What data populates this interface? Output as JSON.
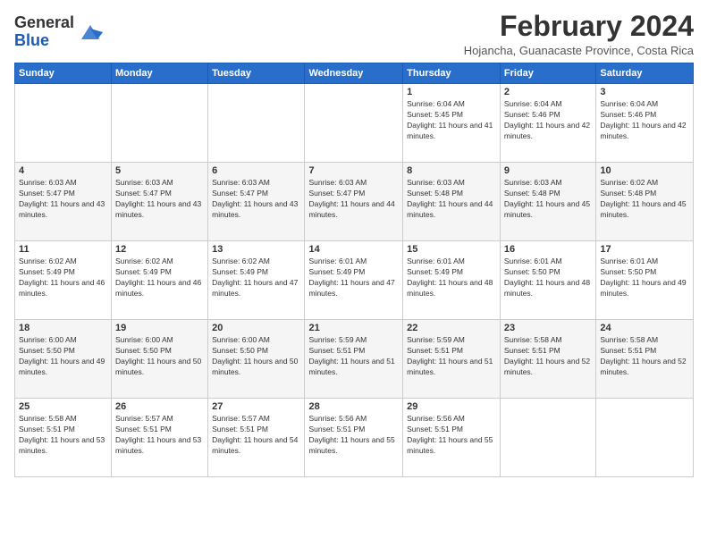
{
  "header": {
    "logo_line1": "General",
    "logo_line2": "Blue",
    "month": "February 2024",
    "location": "Hojancha, Guanacaste Province, Costa Rica"
  },
  "days_of_week": [
    "Sunday",
    "Monday",
    "Tuesday",
    "Wednesday",
    "Thursday",
    "Friday",
    "Saturday"
  ],
  "weeks": [
    [
      {
        "day": "",
        "info": ""
      },
      {
        "day": "",
        "info": ""
      },
      {
        "day": "",
        "info": ""
      },
      {
        "day": "",
        "info": ""
      },
      {
        "day": "1",
        "info": "Sunrise: 6:04 AM\nSunset: 5:45 PM\nDaylight: 11 hours and 41 minutes."
      },
      {
        "day": "2",
        "info": "Sunrise: 6:04 AM\nSunset: 5:46 PM\nDaylight: 11 hours and 42 minutes."
      },
      {
        "day": "3",
        "info": "Sunrise: 6:04 AM\nSunset: 5:46 PM\nDaylight: 11 hours and 42 minutes."
      }
    ],
    [
      {
        "day": "4",
        "info": "Sunrise: 6:03 AM\nSunset: 5:47 PM\nDaylight: 11 hours and 43 minutes."
      },
      {
        "day": "5",
        "info": "Sunrise: 6:03 AM\nSunset: 5:47 PM\nDaylight: 11 hours and 43 minutes."
      },
      {
        "day": "6",
        "info": "Sunrise: 6:03 AM\nSunset: 5:47 PM\nDaylight: 11 hours and 43 minutes."
      },
      {
        "day": "7",
        "info": "Sunrise: 6:03 AM\nSunset: 5:47 PM\nDaylight: 11 hours and 44 minutes."
      },
      {
        "day": "8",
        "info": "Sunrise: 6:03 AM\nSunset: 5:48 PM\nDaylight: 11 hours and 44 minutes."
      },
      {
        "day": "9",
        "info": "Sunrise: 6:03 AM\nSunset: 5:48 PM\nDaylight: 11 hours and 45 minutes."
      },
      {
        "day": "10",
        "info": "Sunrise: 6:02 AM\nSunset: 5:48 PM\nDaylight: 11 hours and 45 minutes."
      }
    ],
    [
      {
        "day": "11",
        "info": "Sunrise: 6:02 AM\nSunset: 5:49 PM\nDaylight: 11 hours and 46 minutes."
      },
      {
        "day": "12",
        "info": "Sunrise: 6:02 AM\nSunset: 5:49 PM\nDaylight: 11 hours and 46 minutes."
      },
      {
        "day": "13",
        "info": "Sunrise: 6:02 AM\nSunset: 5:49 PM\nDaylight: 11 hours and 47 minutes."
      },
      {
        "day": "14",
        "info": "Sunrise: 6:01 AM\nSunset: 5:49 PM\nDaylight: 11 hours and 47 minutes."
      },
      {
        "day": "15",
        "info": "Sunrise: 6:01 AM\nSunset: 5:49 PM\nDaylight: 11 hours and 48 minutes."
      },
      {
        "day": "16",
        "info": "Sunrise: 6:01 AM\nSunset: 5:50 PM\nDaylight: 11 hours and 48 minutes."
      },
      {
        "day": "17",
        "info": "Sunrise: 6:01 AM\nSunset: 5:50 PM\nDaylight: 11 hours and 49 minutes."
      }
    ],
    [
      {
        "day": "18",
        "info": "Sunrise: 6:00 AM\nSunset: 5:50 PM\nDaylight: 11 hours and 49 minutes."
      },
      {
        "day": "19",
        "info": "Sunrise: 6:00 AM\nSunset: 5:50 PM\nDaylight: 11 hours and 50 minutes."
      },
      {
        "day": "20",
        "info": "Sunrise: 6:00 AM\nSunset: 5:50 PM\nDaylight: 11 hours and 50 minutes."
      },
      {
        "day": "21",
        "info": "Sunrise: 5:59 AM\nSunset: 5:51 PM\nDaylight: 11 hours and 51 minutes."
      },
      {
        "day": "22",
        "info": "Sunrise: 5:59 AM\nSunset: 5:51 PM\nDaylight: 11 hours and 51 minutes."
      },
      {
        "day": "23",
        "info": "Sunrise: 5:58 AM\nSunset: 5:51 PM\nDaylight: 11 hours and 52 minutes."
      },
      {
        "day": "24",
        "info": "Sunrise: 5:58 AM\nSunset: 5:51 PM\nDaylight: 11 hours and 52 minutes."
      }
    ],
    [
      {
        "day": "25",
        "info": "Sunrise: 5:58 AM\nSunset: 5:51 PM\nDaylight: 11 hours and 53 minutes."
      },
      {
        "day": "26",
        "info": "Sunrise: 5:57 AM\nSunset: 5:51 PM\nDaylight: 11 hours and 53 minutes."
      },
      {
        "day": "27",
        "info": "Sunrise: 5:57 AM\nSunset: 5:51 PM\nDaylight: 11 hours and 54 minutes."
      },
      {
        "day": "28",
        "info": "Sunrise: 5:56 AM\nSunset: 5:51 PM\nDaylight: 11 hours and 55 minutes."
      },
      {
        "day": "29",
        "info": "Sunrise: 5:56 AM\nSunset: 5:51 PM\nDaylight: 11 hours and 55 minutes."
      },
      {
        "day": "",
        "info": ""
      },
      {
        "day": "",
        "info": ""
      }
    ]
  ]
}
